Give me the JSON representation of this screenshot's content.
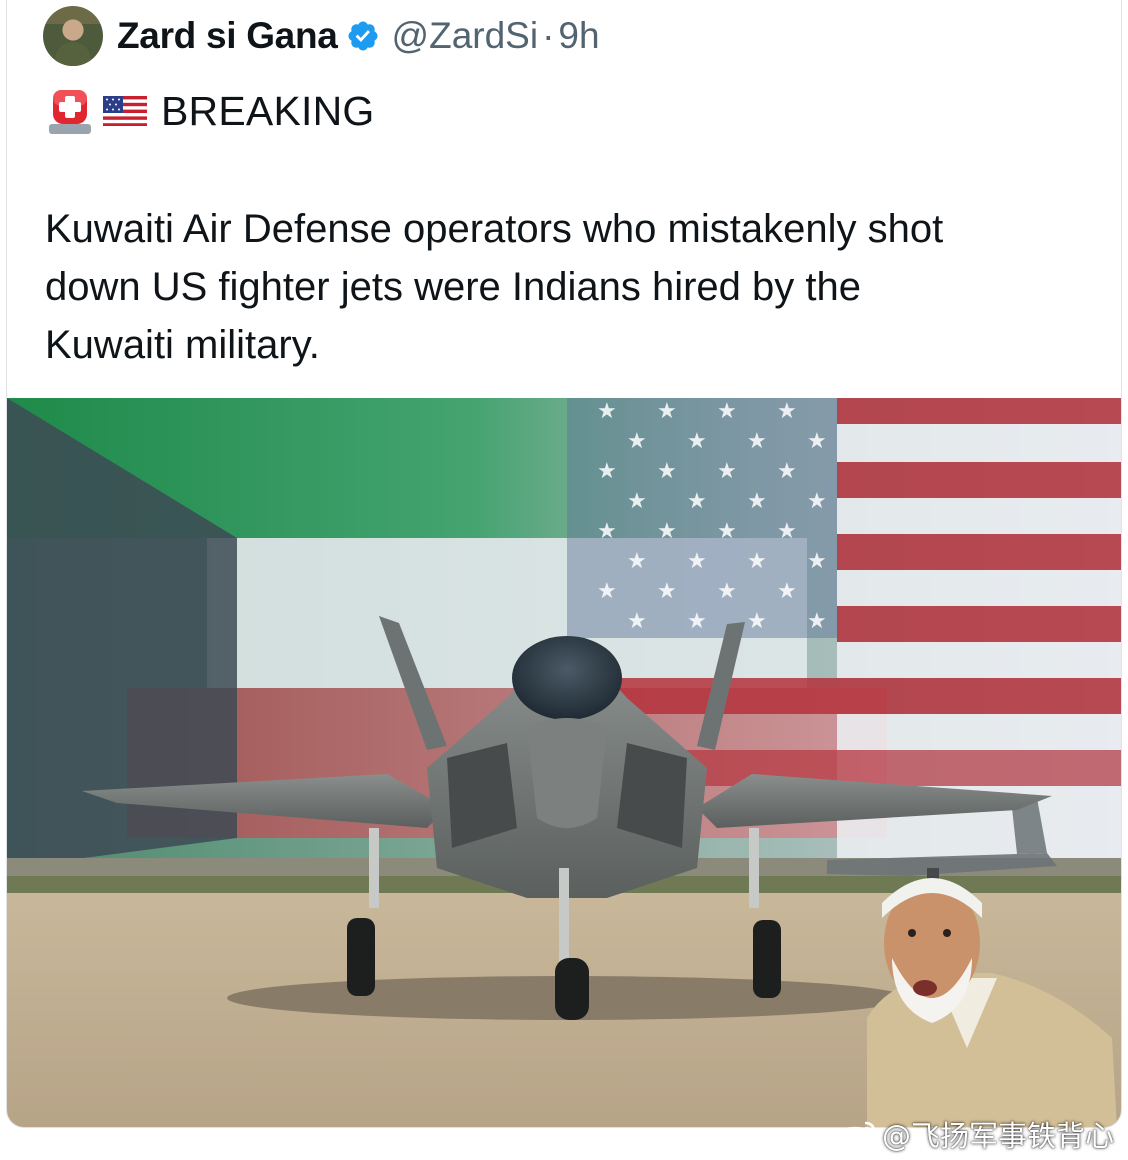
{
  "post": {
    "display_name": "Zard si Gana",
    "handle": "@ZardSi",
    "separator": "·",
    "time": "9h",
    "breaking_label": "BREAKING",
    "body_lines": [
      "Kuwaiti Air Defense operators who mistakenly shot",
      "down US fighter jets were Indians hired by the",
      "Kuwaiti military."
    ]
  },
  "icons": {
    "verified": "verified-badge-icon",
    "siren": "rotating-light-emoji",
    "flag": "us-flag-emoji",
    "watermark": "weibo-icon"
  },
  "watermark": {
    "text": "@飞扬军事铁背心"
  },
  "colors": {
    "verified_blue": "#1d9bf0",
    "secondary_text": "#536471",
    "primary_text": "#0f1419"
  }
}
